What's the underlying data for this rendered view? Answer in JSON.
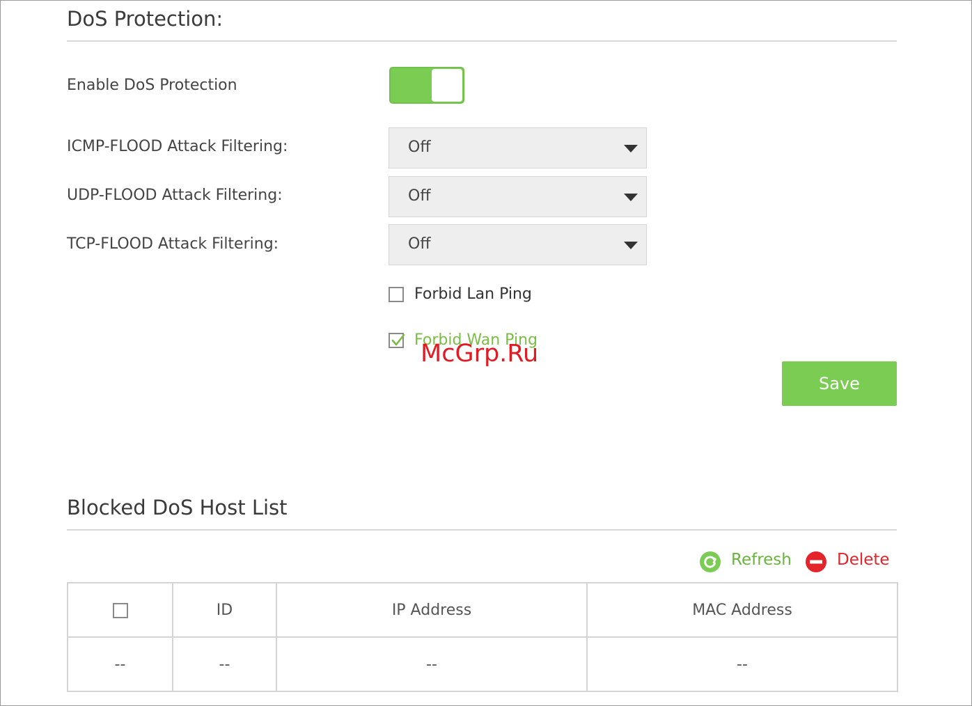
{
  "dos": {
    "title": "DoS Protection:",
    "enable_label": "Enable DoS Protection",
    "enabled": true,
    "icmp_label": "ICMP-FLOOD Attack Filtering:",
    "icmp_value": "Off",
    "udp_label": "UDP-FLOOD Attack Filtering:",
    "udp_value": "Off",
    "tcp_label": "TCP-FLOOD Attack Filtering:",
    "tcp_value": "Off",
    "forbid_lan_label": "Forbid Lan Ping",
    "forbid_lan_checked": false,
    "forbid_wan_label": "Forbid Wan Ping",
    "forbid_wan_checked": true,
    "save_label": "Save"
  },
  "watermark": "McGrp.Ru",
  "blocked": {
    "title": "Blocked DoS Host List",
    "refresh_label": "Refresh",
    "delete_label": "Delete",
    "columns": {
      "id": "ID",
      "ip": "IP Address",
      "mac": "MAC Address"
    },
    "rows": [
      {
        "select": "--",
        "id": "--",
        "ip": "--",
        "mac": "--"
      }
    ]
  },
  "colors": {
    "accent_green": "#7bcc53",
    "delete_red": "#e3242b",
    "watermark_red": "#e11b22"
  },
  "icons": {
    "refresh": "refresh-circle-icon",
    "delete": "minus-circle-icon",
    "dropdown": "triangle-down-icon",
    "check": "checkmark-icon"
  }
}
